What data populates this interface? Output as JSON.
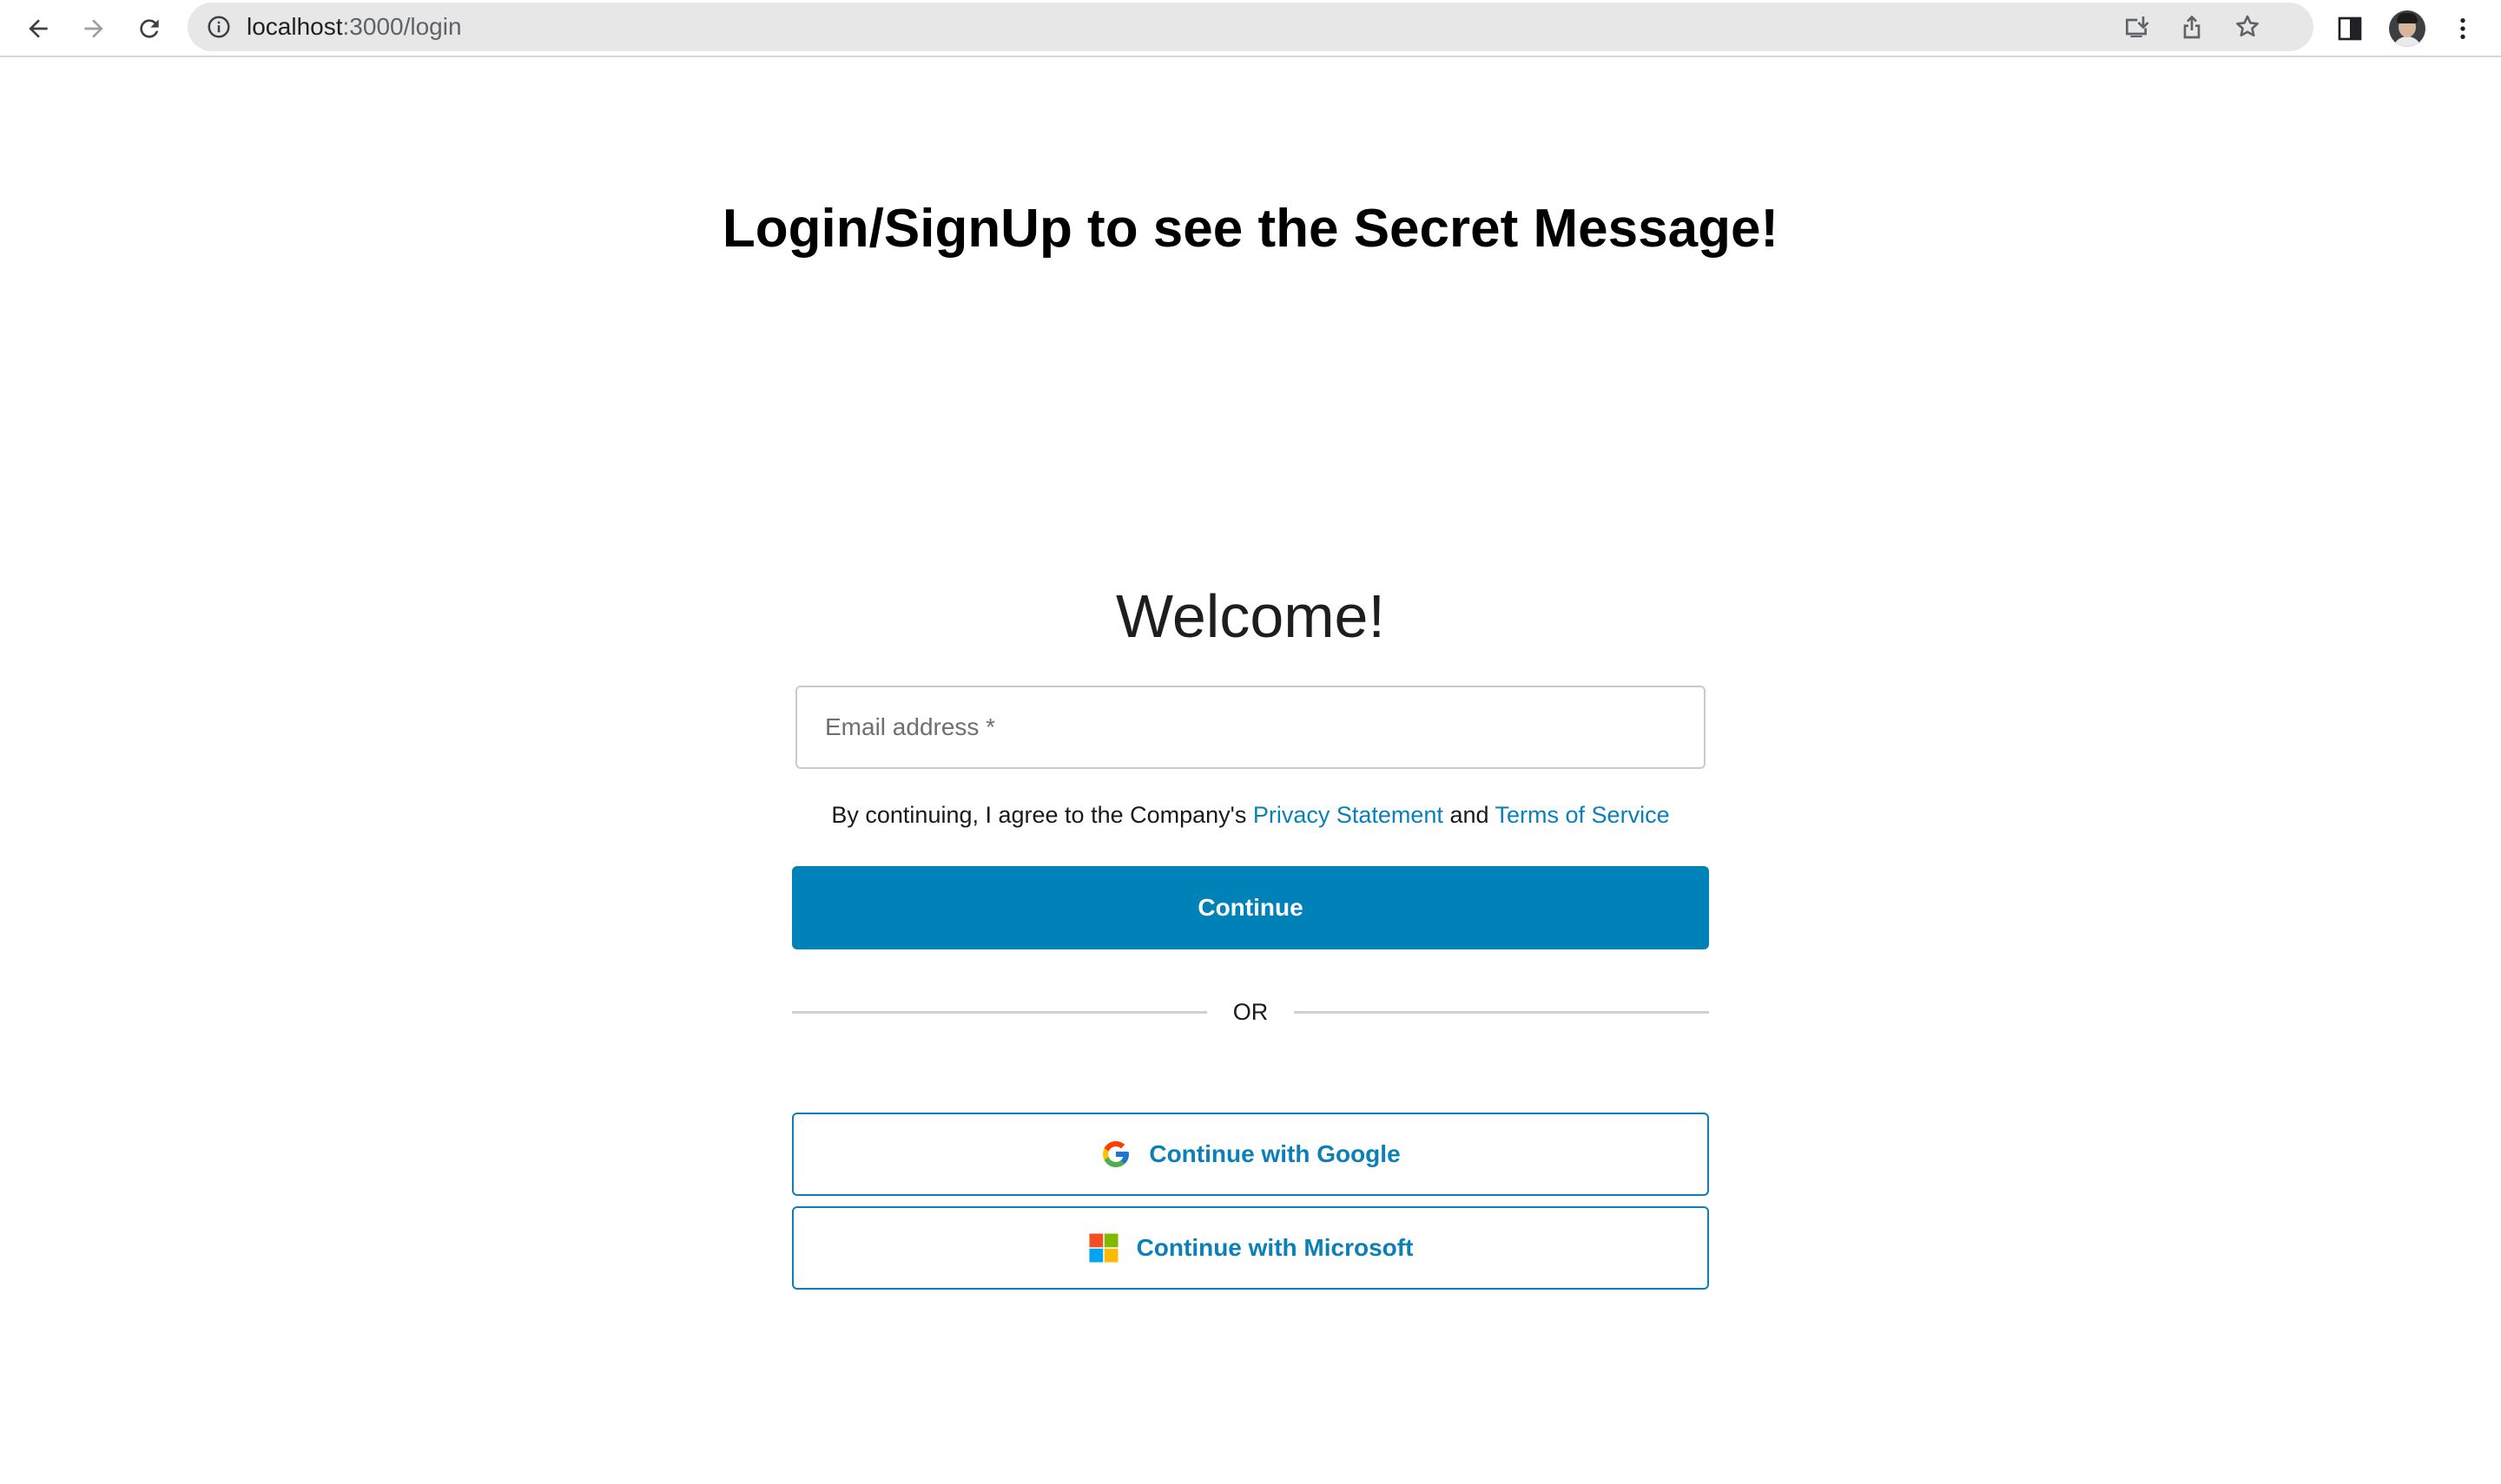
{
  "browser": {
    "url_host": "localhost",
    "url_rest": ":3000/login"
  },
  "page": {
    "title": "Login/SignUp to see the Secret Message!"
  },
  "login": {
    "welcome": "Welcome!",
    "email_placeholder": "Email address *",
    "consent_prefix": "By continuing, I agree to the Company's",
    "privacy_link": "Privacy Statement",
    "consent_and": "and",
    "terms_link": "Terms of Service",
    "continue_label": "Continue",
    "divider_label": "OR",
    "google_label": "Continue with Google",
    "microsoft_label": "Continue with Microsoft"
  },
  "colors": {
    "accent": "#0081b8",
    "link": "#0a7fb8"
  }
}
